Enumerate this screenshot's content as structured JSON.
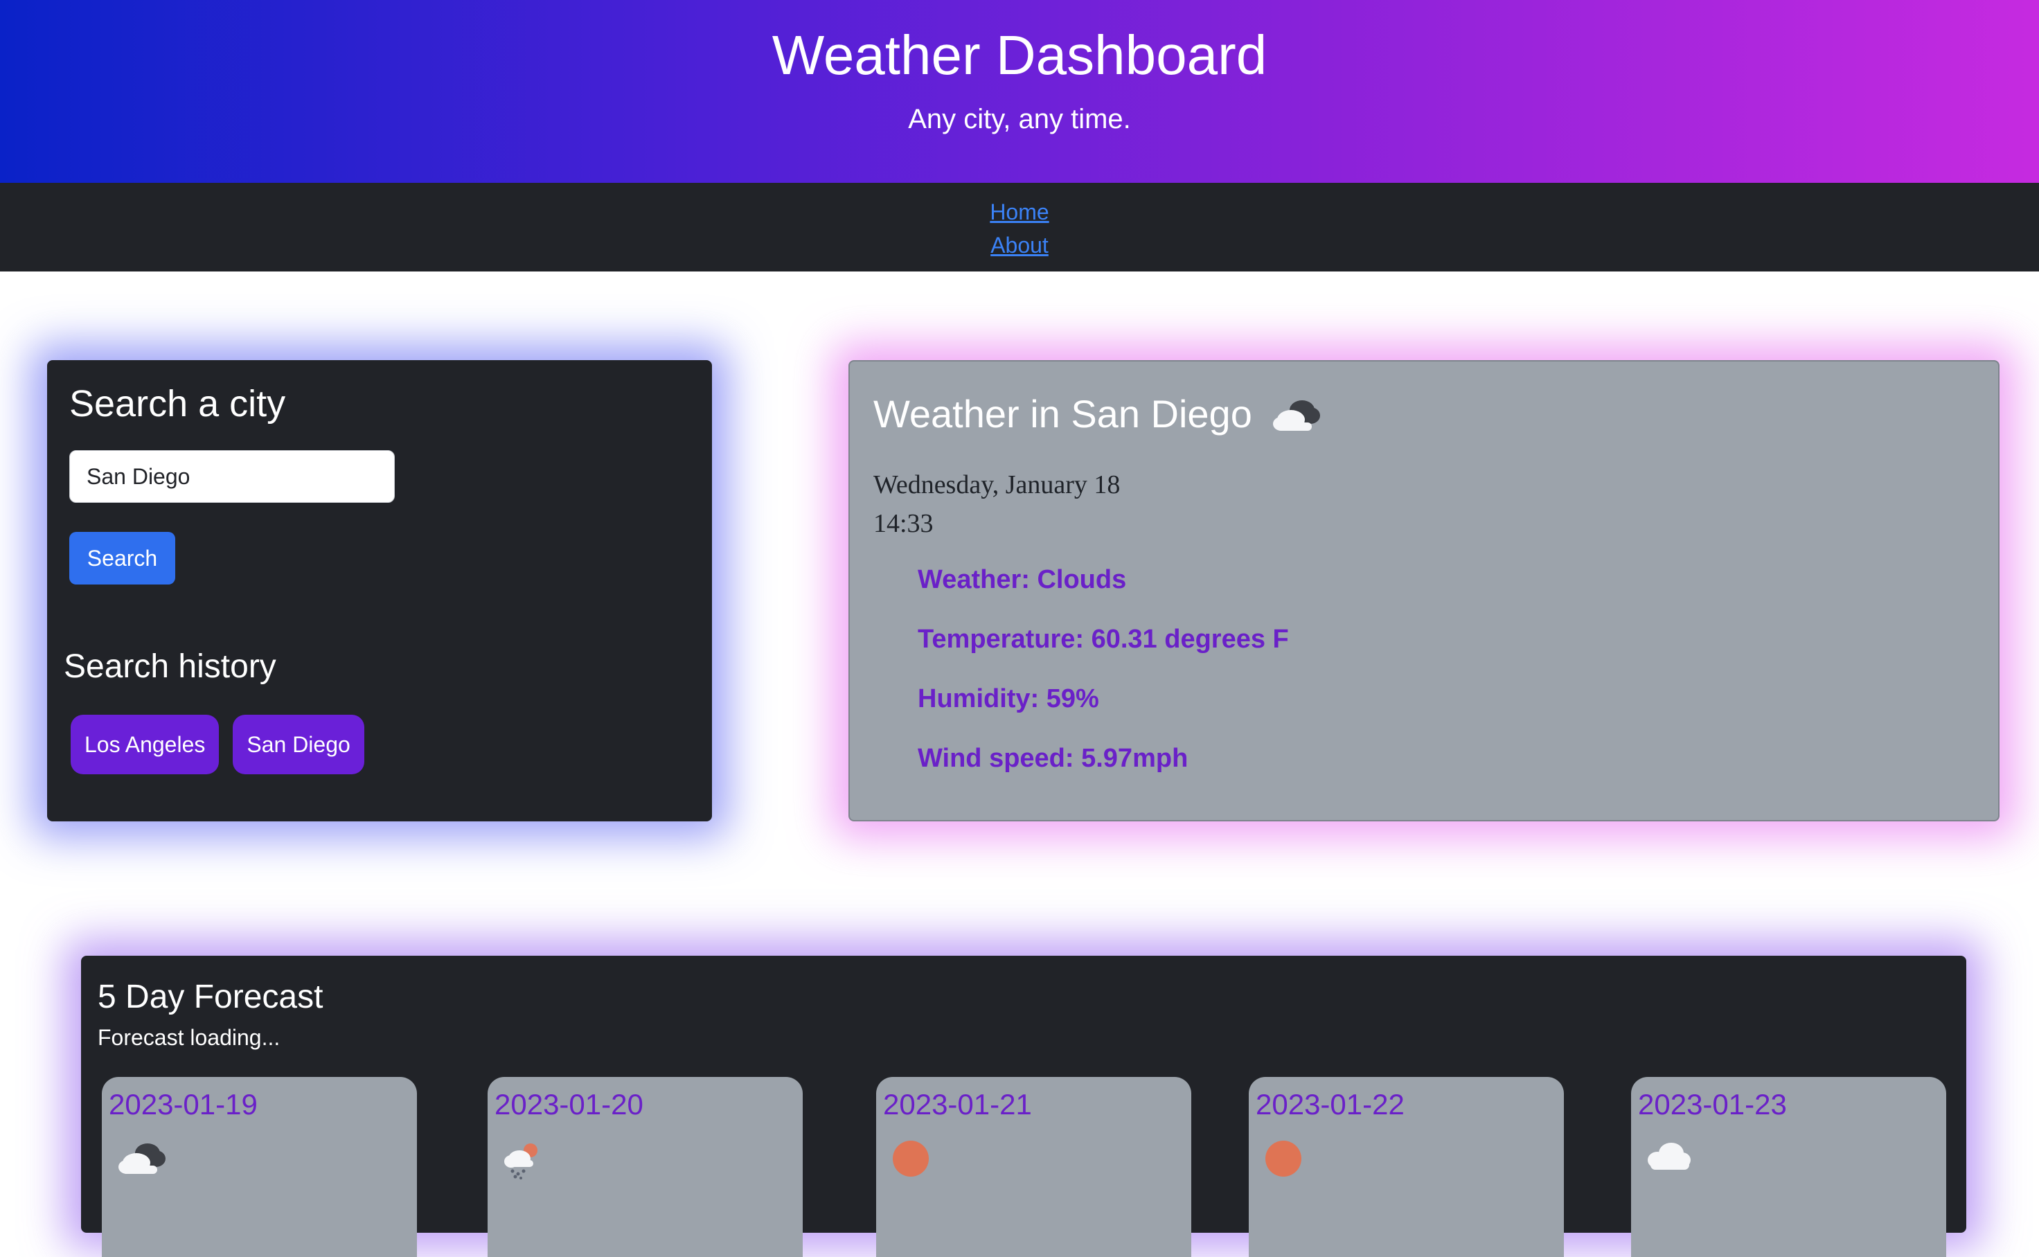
{
  "header": {
    "title": "Weather Dashboard",
    "subtitle": "Any city, any time."
  },
  "nav": {
    "items": [
      {
        "label": "Home"
      },
      {
        "label": "About"
      }
    ],
    "link_color": "#3b82f6"
  },
  "search": {
    "title": "Search a city",
    "input_value": "San Diego",
    "button_label": "Search",
    "history_title": "Search history",
    "history": [
      "Los Angeles",
      "San Diego"
    ]
  },
  "current": {
    "title": "Weather in San Diego",
    "icon": "partly-cloudy-icon",
    "date": "Wednesday, January 18",
    "time": "14:33",
    "weather": "Weather: Clouds",
    "temperature": "Temperature: 60.31 degrees F",
    "humidity": "Humidity: 59%",
    "wind": "Wind speed: 5.97mph"
  },
  "forecast": {
    "title": "5 Day Forecast",
    "status": "Forecast loading...",
    "days": [
      {
        "date": "2023-01-19",
        "icon": "dark-cloud-icon"
      },
      {
        "date": "2023-01-20",
        "icon": "rain-cloud-icon"
      },
      {
        "date": "2023-01-21",
        "icon": "sun-icon"
      },
      {
        "date": "2023-01-22",
        "icon": "sun-icon"
      },
      {
        "date": "2023-01-23",
        "icon": "cloud-icon"
      }
    ]
  },
  "colors": {
    "accent_purple": "#6a20d8",
    "search_button": "#2f6fee",
    "dark_panel": "#212328",
    "grey_panel": "#9ca3ab"
  }
}
